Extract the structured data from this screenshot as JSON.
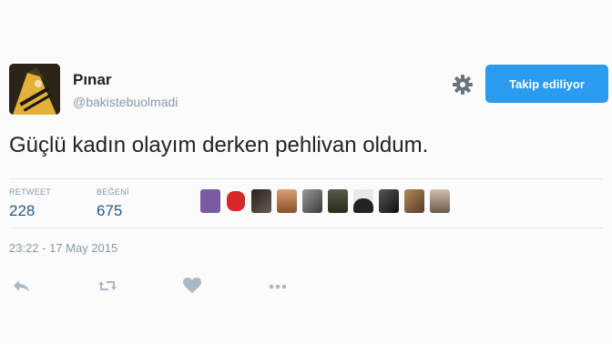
{
  "user": {
    "name": "Pınar",
    "handle": "@bakistebuolmadi"
  },
  "follow_button": {
    "label": "Takip ediliyor"
  },
  "tweet": {
    "text": "Güçlü kadın olayım derken pehlivan oldum."
  },
  "stats": {
    "retweet_label": "RETWEET",
    "retweet_count": "228",
    "like_label": "BEĞENİ",
    "like_count": "675"
  },
  "liker_avatars": [
    {
      "color": "#7a5aa0"
    },
    {
      "color": "#d62828"
    },
    {
      "color": "#3a3030"
    },
    {
      "color": "#c98a5a"
    },
    {
      "color": "#6a6a6a"
    },
    {
      "color": "#4a4a3a"
    },
    {
      "color": "#2a2a2a"
    },
    {
      "color": "#333333"
    },
    {
      "color": "#8a6a4a"
    },
    {
      "color": "#9a8a7a"
    }
  ],
  "timestamp": "23:22 - 17 May 2015",
  "icons": {
    "gear": "gear-icon",
    "reply": "reply-icon",
    "retweet": "retweet-icon",
    "like": "heart-icon",
    "more": "more-icon"
  },
  "colors": {
    "accent": "#2b9bf0",
    "stat_value": "#2a5a84",
    "muted": "#8899a6",
    "icon": "#aab8c2"
  }
}
